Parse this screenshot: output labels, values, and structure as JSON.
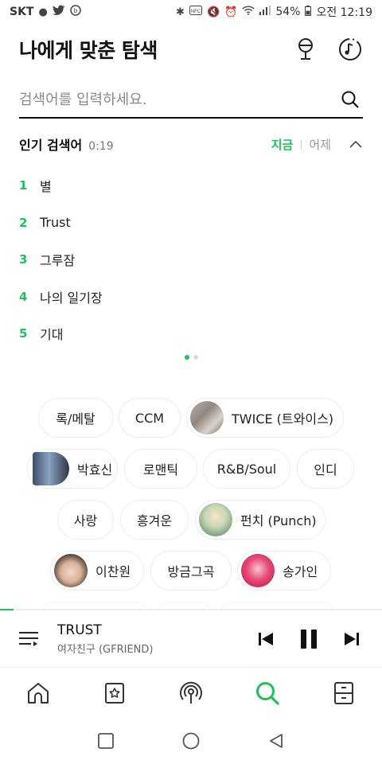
{
  "status_bar": {
    "carrier": "SKT",
    "battery": "54%",
    "time": "오전 12:19"
  },
  "header": {
    "title": "나에게 맞춘 탐색",
    "mic_icon": "microphone-icon",
    "music_icon": "music-recognition-icon"
  },
  "search": {
    "placeholder": "검색어를 입력하세요."
  },
  "popular": {
    "title": "인기 검색어",
    "time": "0:19",
    "tab_now": "지금",
    "tab_yesterday": "어제",
    "items": [
      {
        "rank": "1",
        "word": "별"
      },
      {
        "rank": "2",
        "word": "Trust"
      },
      {
        "rank": "3",
        "word": "그루잠"
      },
      {
        "rank": "4",
        "word": "나의 일기장"
      },
      {
        "rank": "5",
        "word": "기대"
      }
    ],
    "page_count": 2,
    "active_page": 1
  },
  "chips": [
    {
      "label": "록/메탈"
    },
    {
      "label": "CCM"
    },
    {
      "label": "TWICE (트와이스)"
    },
    {
      "label": "박효신"
    },
    {
      "label": "로맨틱"
    },
    {
      "label": "R&B/Soul"
    },
    {
      "label": "인디"
    },
    {
      "label": "사랑"
    },
    {
      "label": "흥겨운"
    },
    {
      "label": "펀치 (Punch)"
    },
    {
      "label": "이찬원"
    },
    {
      "label": "방금그곡"
    },
    {
      "label": "송가인"
    }
  ],
  "player": {
    "title": "TRUST",
    "artist": "여자친구 (GFRIEND)",
    "progress": 0.035
  },
  "bottom_nav": [
    "home-icon",
    "playlist-icon",
    "radio-icon",
    "search-icon",
    "storage-icon"
  ],
  "colors": {
    "accent": "#1fc15a",
    "text": "#111111",
    "muted": "#8a8a8a",
    "border": "#ececec"
  }
}
